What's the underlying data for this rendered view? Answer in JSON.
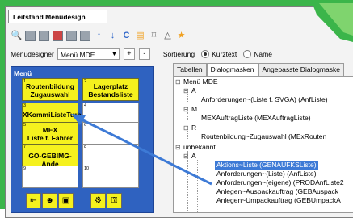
{
  "window_title": "Leitstand Menüdesign",
  "toolbar_icons": [
    "search-icon",
    "grid-icon",
    "list-icon",
    "user-icon",
    "table-icon",
    "edit-icon",
    "arrow-up-icon",
    "arrow-down-icon",
    "refresh-icon",
    "save-icon",
    "brush-icon",
    "warning-icon",
    "star-icon"
  ],
  "menudesigner": {
    "label": "Menüdesigner",
    "value": "Menü MDE",
    "add": "+",
    "remove": "-"
  },
  "sort": {
    "label": "Sortierung",
    "opt1": "Kurztext",
    "opt2": "Name",
    "selected": "Kurztext"
  },
  "menu": {
    "title": "Menü",
    "tiles": [
      {
        "num": "1",
        "text": [
          "Routenbildung",
          "Zugauswahl"
        ],
        "yellow": true
      },
      {
        "num": "2",
        "text": [
          "Lagerplatz",
          "Bestandsliste"
        ],
        "yellow": true
      },
      {
        "num": "3",
        "text": [
          "XKommiListeTurb"
        ],
        "yellow": true
      },
      {
        "num": "4",
        "text": [
          ""
        ],
        "yellow": false
      },
      {
        "num": "5",
        "text": [
          "MEX",
          "Liste f. Fahrer"
        ],
        "yellow": true
      },
      {
        "num": "6",
        "text": [
          ""
        ],
        "yellow": false
      },
      {
        "num": "7",
        "text": [
          "GO-GEBIMG-Ände"
        ],
        "yellow": true
      },
      {
        "num": "8",
        "text": [
          ""
        ],
        "yellow": false
      },
      {
        "num": "9",
        "text": [
          ""
        ],
        "yellow": false
      },
      {
        "num": "10",
        "text": [
          ""
        ],
        "yellow": false
      }
    ]
  },
  "tabs": [
    "Tabellen",
    "Dialogmasken",
    "Angepasste Dialogmaske"
  ],
  "active_tab": "Dialogmasken",
  "tree": {
    "root": "Menü MDE",
    "a_label": "A",
    "a_item": "Anforderungen~(Liste f. SVGA) (AnfListe)",
    "m_label": "M",
    "m_item": "MEXAuftragListe (MEXAuftragListe)",
    "r_label": "R",
    "r_item": "Routenbildung~Zugauswahl (MExRouten",
    "unknown": "unbekannt",
    "a2_label": "A",
    "items": [
      "Aktions~Liste (GENAUFKSListe)",
      "Anforderungen~(Liste) (AnfListe)",
      "Anforderungen~(eigene) (PRODAnfListe2",
      "Anlegen~Auspackauftrag (GEBAuspack",
      "Anlegen~Umpackauftrag (GEBUmpackA"
    ],
    "selected_item": "Aktions~Liste (GENAUFKSListe)"
  },
  "bottom_icons": [
    "exit-icon",
    "people-icon",
    "vehicle-icon",
    "pallet-icon",
    "key-icon"
  ]
}
